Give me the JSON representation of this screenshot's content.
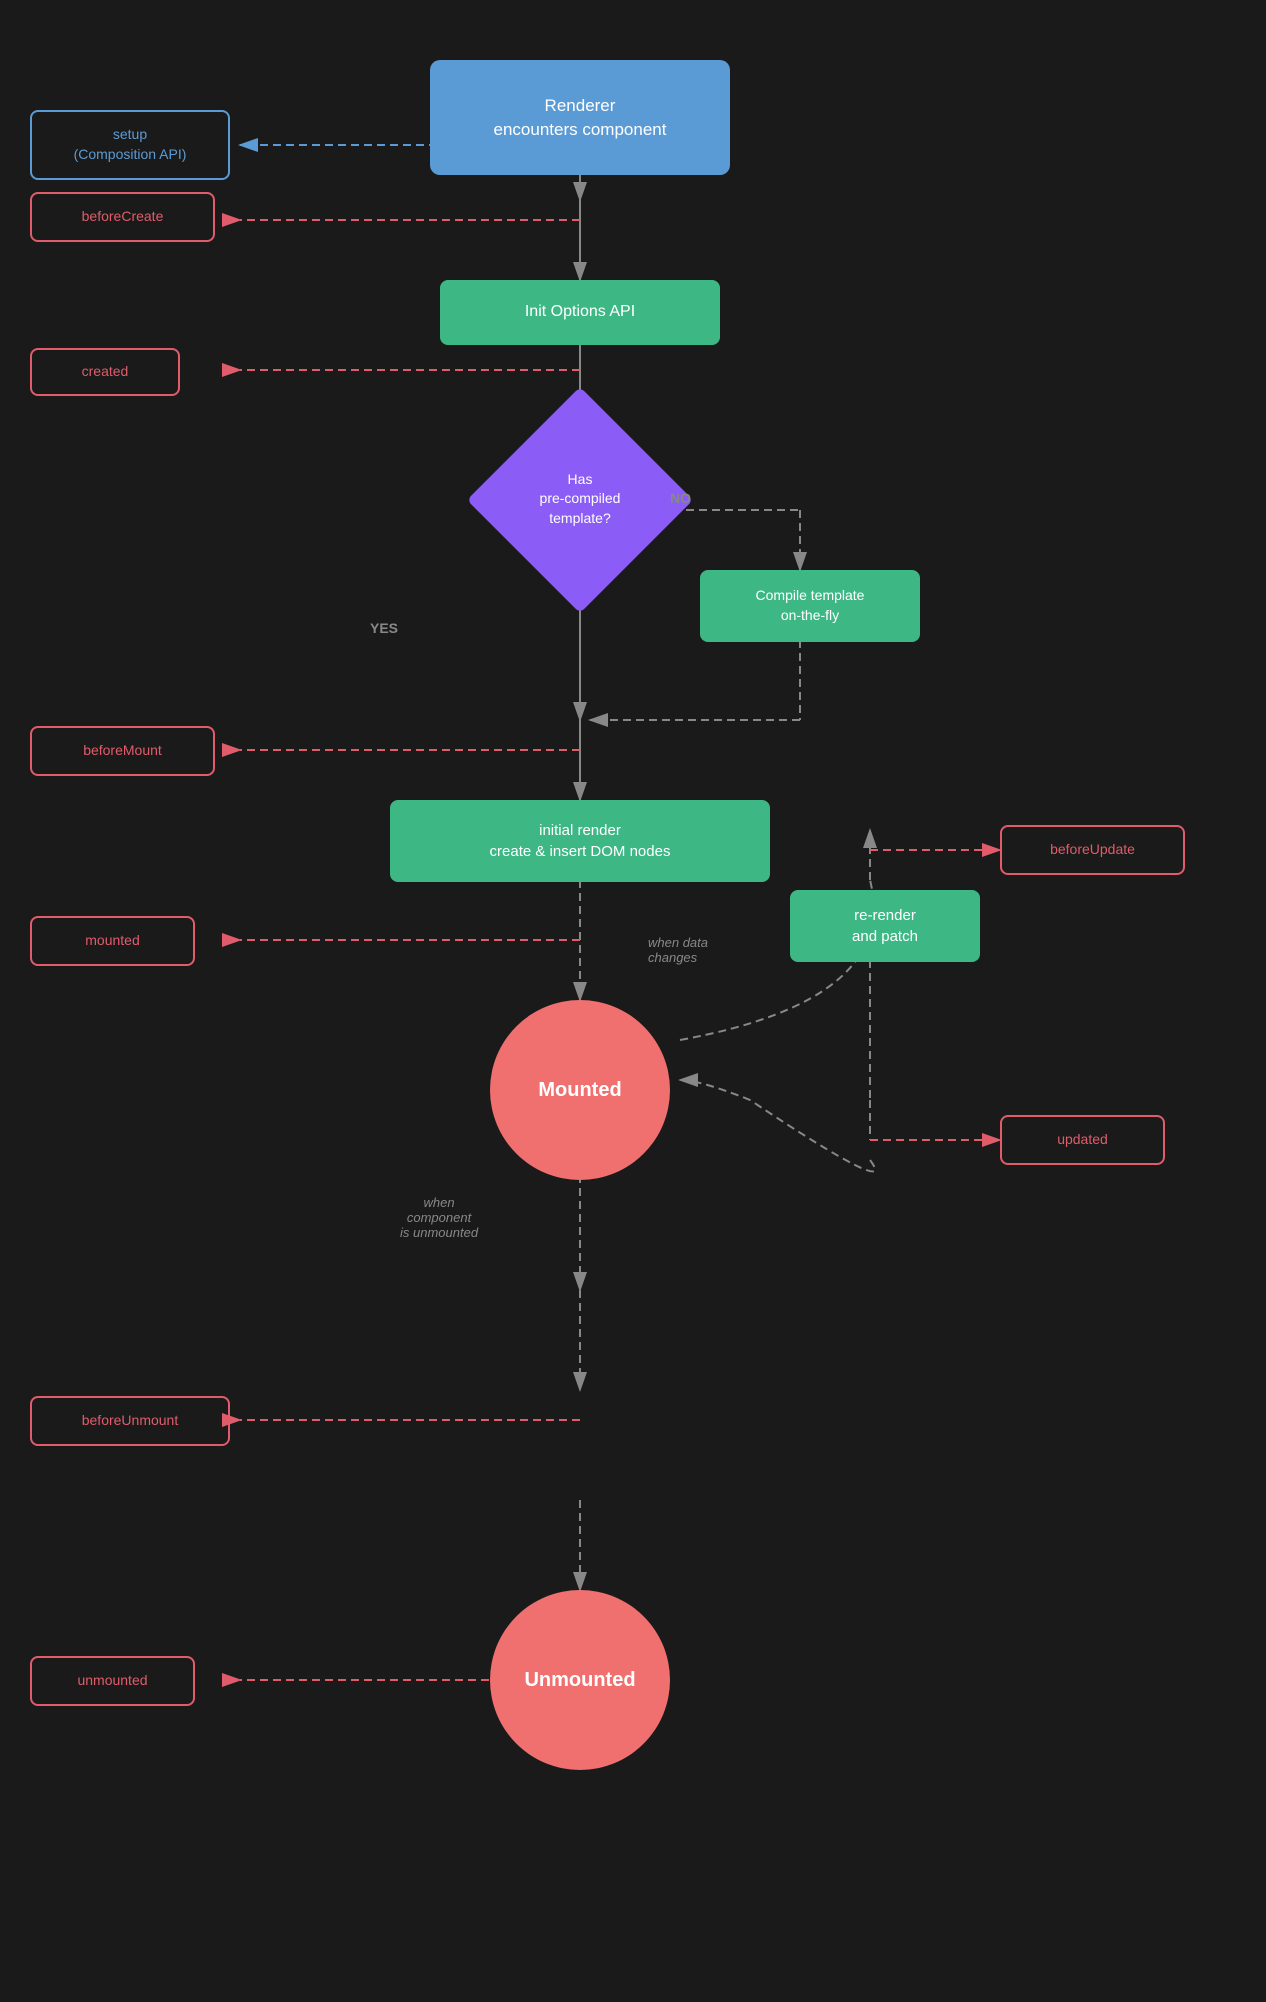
{
  "nodes": {
    "renderer": {
      "label": "Renderer\nencounters component"
    },
    "setup": {
      "label": "setup\n(Composition API)"
    },
    "beforeCreate": {
      "label": "beforeCreate"
    },
    "initOptionsAPI": {
      "label": "Init Options API"
    },
    "created": {
      "label": "created"
    },
    "diamond": {
      "label": "Has\npre-compiled\ntemplate?"
    },
    "compileTemplate": {
      "label": "Compile template\non-the-fly"
    },
    "beforeMount": {
      "label": "beforeMount"
    },
    "initialRender": {
      "label": "initial render\ncreate & insert DOM nodes"
    },
    "mounted_label": {
      "label": "mounted"
    },
    "mounted_circle": {
      "label": "Mounted"
    },
    "beforeUpdate": {
      "label": "beforeUpdate"
    },
    "rerender": {
      "label": "re-render\nand patch"
    },
    "updated": {
      "label": "updated"
    },
    "beforeUnmount": {
      "label": "beforeUnmount"
    },
    "unmounted_label": {
      "label": "unmounted"
    },
    "unmounted_circle": {
      "label": "Unmounted"
    },
    "when_data_changes": {
      "label": "when data\nchanges"
    },
    "when_unmounted": {
      "label": "when\ncomponent\nis unmounted"
    },
    "no_label": {
      "label": "NO"
    },
    "yes_label": {
      "label": "YES"
    }
  }
}
